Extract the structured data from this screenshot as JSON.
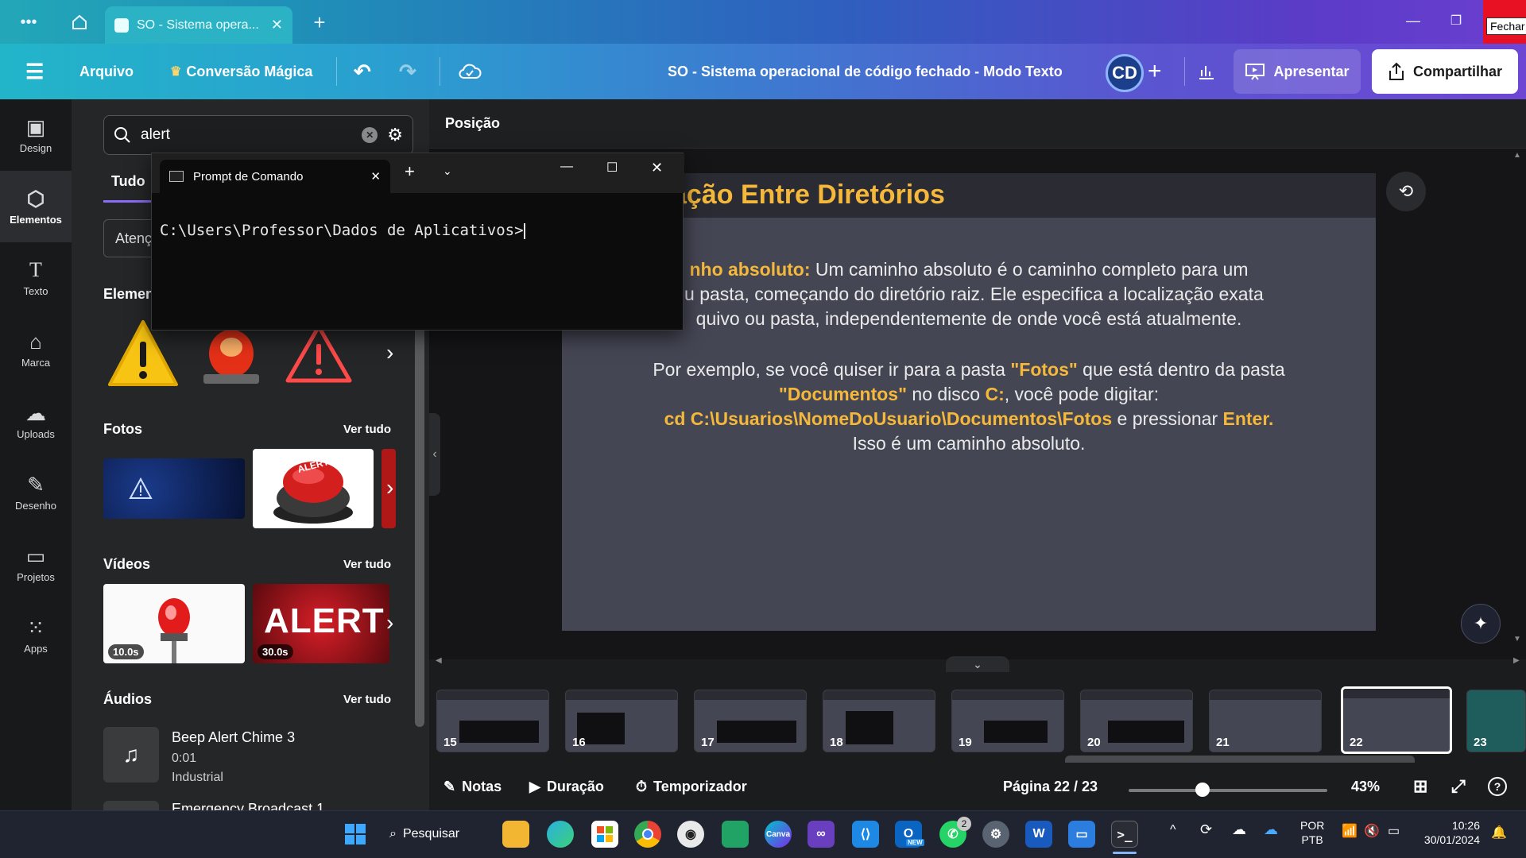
{
  "browser": {
    "tab_title": "SO - Sistema opera...",
    "close_tooltip": "Fechar"
  },
  "header": {
    "menu": [
      "Arquivo",
      "Conversão Mágica"
    ],
    "doc_title": "SO - Sistema operacional de código fechado - Modo Texto",
    "avatar_initials": "CD",
    "apresentar": "Apresentar",
    "compartilhar": "Compartilhar"
  },
  "rail": [
    {
      "label": "Design",
      "icon": "layout-icon"
    },
    {
      "label": "Elementos",
      "icon": "shapes-icon"
    },
    {
      "label": "Texto",
      "icon": "text-icon"
    },
    {
      "label": "Marca",
      "icon": "brand-icon"
    },
    {
      "label": "Uploads",
      "icon": "upload-icon"
    },
    {
      "label": "Desenho",
      "icon": "draw-icon"
    },
    {
      "label": "Projetos",
      "icon": "folder-icon"
    },
    {
      "label": "Apps",
      "icon": "apps-icon"
    }
  ],
  "panel": {
    "search_value": "alert",
    "tab_all": "Tudo",
    "filter_partial": "Atenç",
    "sections": {
      "elements": "Elemen",
      "photos": "Fotos",
      "videos": "Vídeos",
      "audios": "Áudios"
    },
    "see_all": "Ver tudo",
    "videos": [
      {
        "duration": "10.0s"
      },
      {
        "duration": "30.0s",
        "caption": "ALERT"
      }
    ],
    "photo_button_text": "ALERT",
    "audio": {
      "title": "Beep Alert Chime 3",
      "duration": "0:01",
      "genre": "Industrial",
      "next_partial": "Emergency Broadcast 1"
    }
  },
  "cmd": {
    "title": "Prompt de Comando",
    "prompt": "C:\\Users\\Professor\\Dados de Aplicativos>"
  },
  "canvas": {
    "position_label": "Posição",
    "slide_title": "ação Entre Diretórios",
    "para1": {
      "lead": "nho absoluto:",
      "lines": [
        " Um caminho absoluto é o caminho completo para um",
        "ou pasta, começando do diretório raiz. Ele especifica a localização exata",
        "quivo ou pasta, independentemente de onde você está atualmente."
      ]
    },
    "para2": {
      "line1_a": "Por exemplo, se você quiser ir para a pasta ",
      "line1_hl": "\"Fotos\"",
      "line1_b": " que está dentro da pasta",
      "line2_hl1": "\"Documentos\"",
      "line2_a": " no disco ",
      "line2_hl2": "C:",
      "line2_b": ", você pode digitar:",
      "line3_hl": "cd C:\\Usuarios\\NomeDoUsuario\\Documentos\\Fotos",
      "line3_a": " e pressionar ",
      "line3_hl2": "Enter.",
      "line4": "Isso é um caminho absoluto."
    }
  },
  "filmstrip": {
    "pages": [
      "15",
      "16",
      "17",
      "18",
      "19",
      "20",
      "21",
      "22",
      "23"
    ],
    "active": "22"
  },
  "bottombar": {
    "notes": "Notas",
    "duration": "Duração",
    "timer": "Temporizador",
    "page": "Página 22 / 23",
    "zoom": "43%",
    "zoom_level": 0.43
  },
  "taskbar": {
    "search": "Pesquisar",
    "lang1": "POR",
    "lang2": "PTB",
    "time": "10:26",
    "date": "30/01/2024",
    "whatsapp_badge": "2",
    "new_badge": "NEW"
  },
  "colors": {
    "accent_yellow": "#f5b83a",
    "slide_bg": "#454654",
    "header_gradient_start": "#22b5c9",
    "header_gradient_end": "#6d46d4"
  }
}
